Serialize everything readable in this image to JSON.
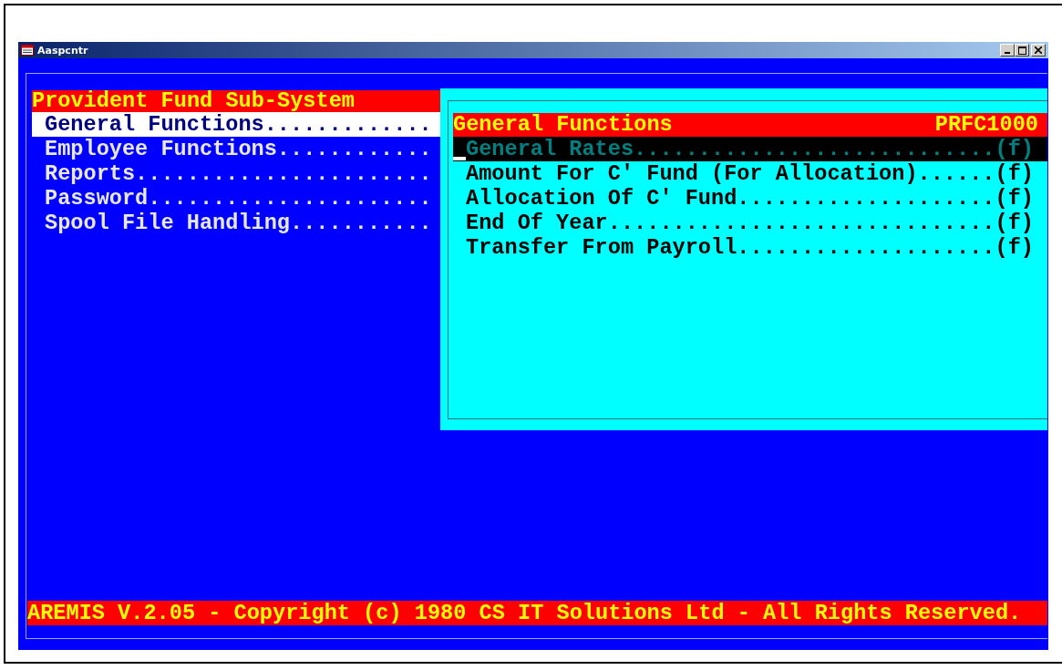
{
  "window": {
    "title": "Aaspcntr"
  },
  "main_menu": {
    "title": "Provident Fund Sub-System",
    "items": [
      {
        "label": "General Functions.............",
        "selected": true
      },
      {
        "label": "Employee Functions............",
        "selected": false
      },
      {
        "label": "Reports.......................",
        "selected": false
      },
      {
        "label": "Password......................",
        "selected": false
      },
      {
        "label": "Spool File Handling...........",
        "selected": false
      }
    ]
  },
  "submenu": {
    "title": "General Functions",
    "code": "PRFC1000",
    "items": [
      {
        "label": "General Rates............................(f)",
        "selected": true
      },
      {
        "label": "Amount For C' Fund (For Allocation)......(f)",
        "selected": false
      },
      {
        "label": "Allocation Of C' Fund....................(f)",
        "selected": false
      },
      {
        "label": "End Of Year..............................(f)",
        "selected": false
      },
      {
        "label": "Transfer From Payroll....................(f)",
        "selected": false
      }
    ]
  },
  "status_bar": "AREMIS V.2.05 - Copyright (c) 1980 CS IT Solutions Ltd - All Rights Reserved."
}
